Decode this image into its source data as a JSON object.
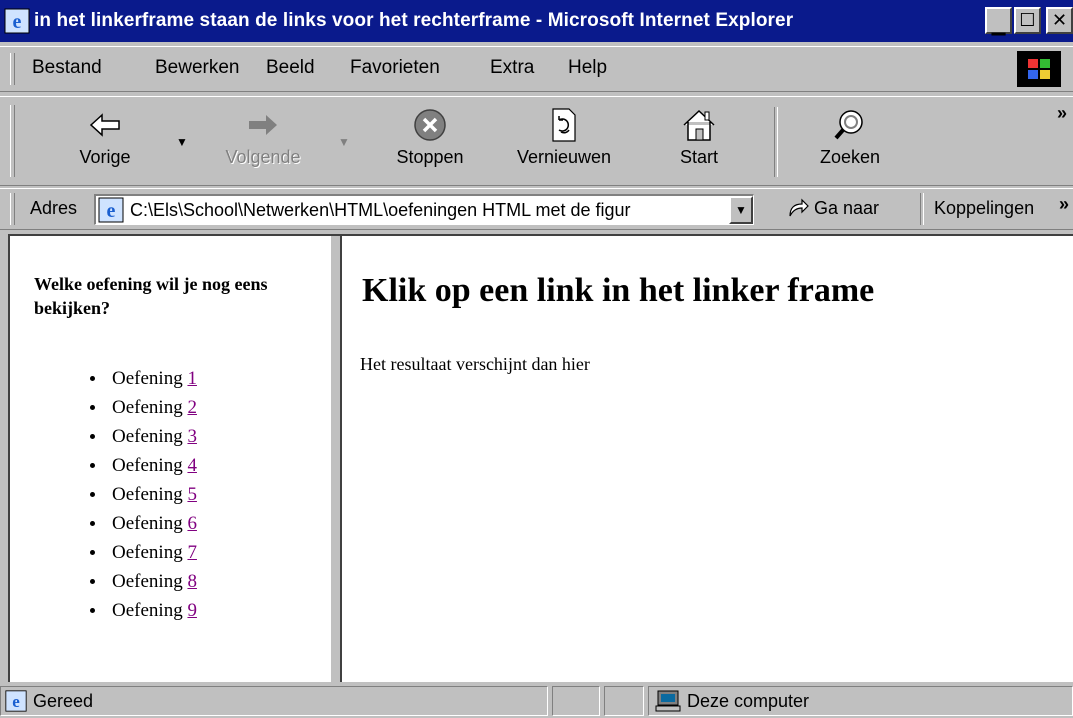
{
  "window": {
    "title": "in het linkerframe staan de links voor het rechterframe - Microsoft Internet Explorer",
    "controls": [
      "minimize",
      "maximize",
      "close"
    ]
  },
  "menu": {
    "items": [
      "Bestand",
      "Bewerken",
      "Beeld",
      "Favorieten",
      "Extra",
      "Help"
    ]
  },
  "toolbar": {
    "back_label": "Vorige",
    "forward_label": "Volgende",
    "stop_label": "Stoppen",
    "refresh_label": "Vernieuwen",
    "home_label": "Start",
    "search_label": "Zoeken",
    "overflow": "»"
  },
  "address": {
    "label": "Adres",
    "value": "C:\\Els\\School\\Netwerken\\HTML\\oefeningen HTML met de figur",
    "go_label": "Ga naar",
    "links_label": "Koppelingen",
    "links_overflow": "»"
  },
  "left_frame": {
    "heading": "Welke oefening wil je nog eens bekijken?",
    "exercise_word": "Oefening",
    "exercises": [
      "1",
      "2",
      "3",
      "4",
      "5",
      "6",
      "7",
      "8",
      "9"
    ]
  },
  "right_frame": {
    "title": "Klik op een link in het linker frame",
    "text": "Het resultaat verschijnt dan hier"
  },
  "status": {
    "text": "Gereed",
    "zone": "Deze computer"
  },
  "colors": {
    "titlebar": "#0a1a8c",
    "chrome": "#c0c0c0",
    "visited_link": "#800080"
  }
}
